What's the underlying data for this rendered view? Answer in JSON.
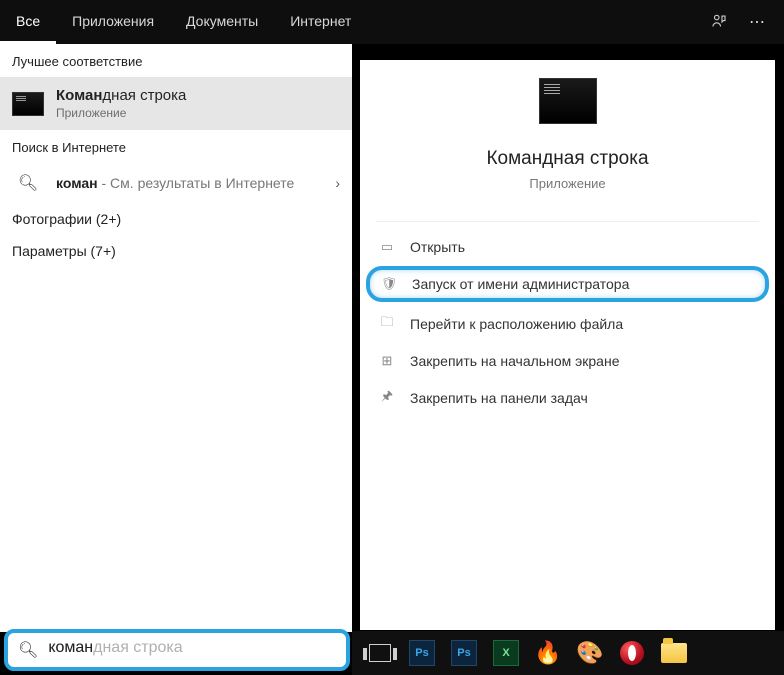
{
  "tabs": {
    "all": "Все",
    "apps": "Приложения",
    "docs": "Документы",
    "web": "Интернет",
    "more": "Другие"
  },
  "sections": {
    "best_match": "Лучшее соответствие",
    "web_search": "Поиск в Интернете"
  },
  "best_match": {
    "prefix": "Коман",
    "rest": "дная строка",
    "subtitle": "Приложение"
  },
  "web_row": {
    "prefix": "коман",
    "sub": " - См. результаты в Интернете"
  },
  "categories": {
    "photos": "Фотографии (2+)",
    "settings": "Параметры (7+)"
  },
  "details": {
    "title": "Командная строка",
    "subtitle": "Приложение",
    "actions": {
      "open": "Открыть",
      "run_admin": "Запуск от имени администратора",
      "open_loc": "Перейти к расположению файла",
      "pin_start": "Закрепить на начальном экране",
      "pin_taskbar": "Закрепить на панели задач"
    }
  },
  "search": {
    "typed": "коман",
    "ghost_full": "командная строка"
  },
  "icons": {
    "feedback": "feedback-icon",
    "more": "more-icon",
    "magnifier": "search-icon",
    "chevron_right": "chevron-right-icon",
    "chevron_down": "chevron-down-icon"
  },
  "taskbar": {
    "taskview": "task-view",
    "ps1": "Ps",
    "ps2": "Ps",
    "excel": "X",
    "burn": "🔥",
    "paint": "🎨",
    "opera": "opera",
    "explorer": "explorer"
  }
}
